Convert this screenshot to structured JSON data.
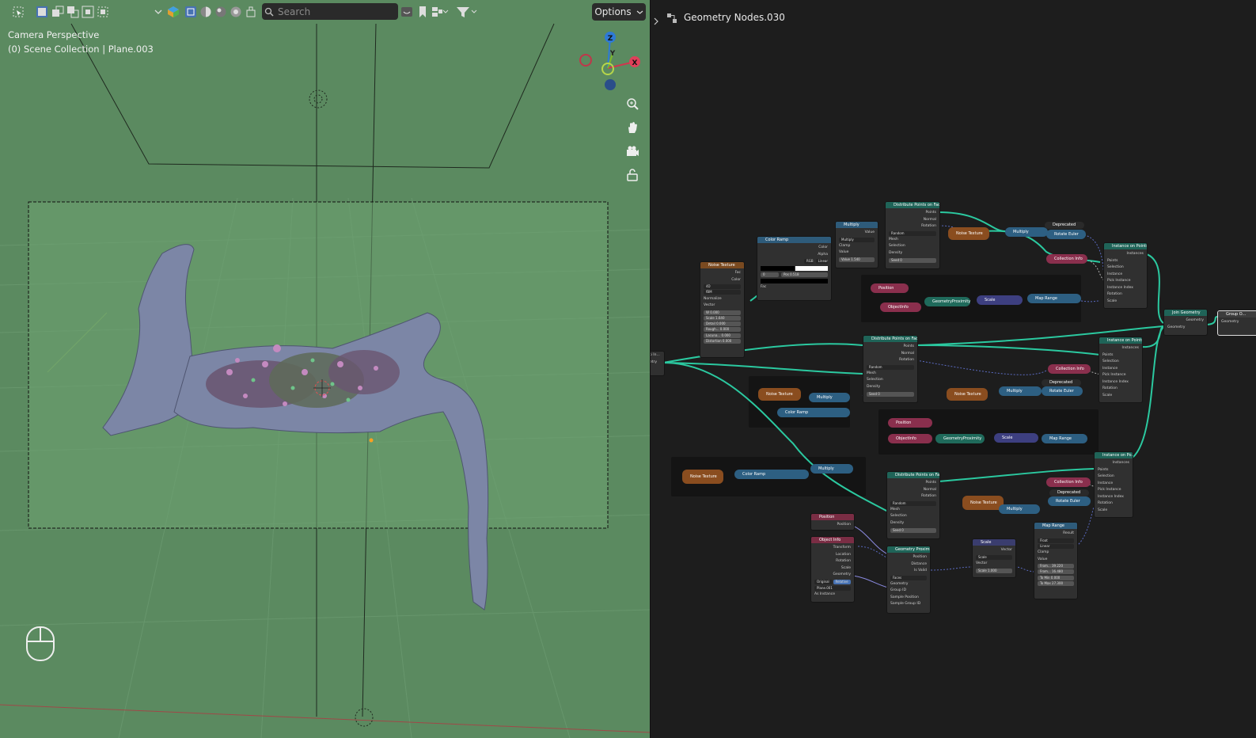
{
  "viewport": {
    "header": {
      "search_placeholder": "Search",
      "options_label": "Options",
      "icons": [
        "select-box-icon",
        "select-new-icon",
        "select-extend-icon",
        "select-subtract-icon",
        "select-intersect-icon",
        "dropdown-icon",
        "object-type-visibility-icon",
        "solid-shading-icon",
        "wireframe-shading-icon",
        "material-preview-icon",
        "rendered-shading-icon",
        "xray-icon",
        "bookmark-icon",
        "view-layer-icon",
        "filter-icon"
      ]
    },
    "overlay": {
      "camera_label": "Camera Perspective",
      "collection_label": "(0) Scene Collection | Plane.003"
    },
    "gizmo": {
      "z_label": "Z",
      "y_label": "Y",
      "x_label": "X"
    },
    "nav_buttons": [
      "zoom-icon",
      "pan-hand-icon",
      "camera-view-icon",
      "lock-icon"
    ],
    "background_color": "#5b8a60"
  },
  "node_editor": {
    "title": "Geometry Nodes.030",
    "group_input_labels": [
      "p In...",
      "etry"
    ],
    "nodes": {
      "noise_texture": {
        "title": "Noise Texture",
        "outputs": [
          "Fac",
          "Color"
        ],
        "dims": "4D",
        "type": "fBM",
        "normalize": "Normalize",
        "vector": "Vector",
        "fields": [
          [
            "W",
            "0.000"
          ],
          [
            "Scale",
            "1.640"
          ],
          [
            "Detail",
            "0.000"
          ],
          [
            "Rough...",
            "0.000"
          ],
          [
            "Lacuna...",
            "0.000"
          ],
          [
            "Distortion",
            "0.000"
          ]
        ]
      },
      "color_ramp": {
        "title": "Color Ramp",
        "outputs": [
          "Color",
          "Alpha"
        ],
        "mode": "RGB",
        "interp": "Linear",
        "index": "0",
        "pos_label": "Pos",
        "pos_value": "0.518",
        "input": "Fac"
      },
      "multiply_top": {
        "title": "Multiply",
        "output": "Value",
        "op": "Multiply",
        "clamp": "Clamp",
        "value_label": "Value",
        "value_field": "Value",
        "value_number": "1.540"
      },
      "distribute_1": {
        "title": "Distribute Points on Faces",
        "outputs": [
          "Points",
          "Normal",
          "Rotation"
        ],
        "mode": "Random",
        "inputs": [
          "Mesh",
          "Selection",
          "Density"
        ],
        "seed_label": "Seed",
        "seed_value": "0"
      },
      "distribute_2": {
        "title": "Distribute Points on Faces",
        "outputs": [
          "Points",
          "Normal",
          "Rotation"
        ],
        "mode": "Random",
        "inputs": [
          "Mesh",
          "Selection",
          "Density"
        ],
        "seed_label": "Seed",
        "seed_value": "0"
      },
      "distribute_3": {
        "title": "Distribute Points on Faces",
        "outputs": [
          "Points",
          "Normal",
          "Rotation"
        ],
        "mode": "Random",
        "inputs": [
          "Mesh",
          "Selection",
          "Density"
        ],
        "seed_label": "Seed",
        "seed_value": "0"
      },
      "instance_1": {
        "title": "Instance on Points",
        "output": "Instances",
        "inputs": [
          "Points",
          "Selection",
          "Instance",
          "Pick Instance",
          "Instance Index",
          "Rotation",
          "Scale"
        ]
      },
      "instance_2": {
        "title": "Instance on Points",
        "output": "Instances",
        "inputs": [
          "Points",
          "Selection",
          "Instance",
          "Pick Instance",
          "Instance Index",
          "Rotation",
          "Scale"
        ]
      },
      "instance_3": {
        "title": "Instance on Po...",
        "output": "Instances",
        "inputs": [
          "Points",
          "Selection",
          "Instance",
          "Pick Instance",
          "Instance Index",
          "Rotation",
          "Scale"
        ]
      },
      "join_geometry": {
        "title": "Join Geometry",
        "output": "Geometry",
        "input": "Geometry"
      },
      "group_output": {
        "title": "Group O...",
        "input": "Geometry"
      },
      "position_node": {
        "title": "Position",
        "output": "Position"
      },
      "object_info": {
        "title": "Object Info",
        "outputs": [
          "Transform",
          "Location",
          "Rotation",
          "Scale",
          "Geometry"
        ],
        "btn_original": "Original",
        "btn_relative": "Relative",
        "object": "Plane.001",
        "as_instance": "As Instance"
      },
      "geometry_proximity": {
        "title": "Geometry Proximity",
        "outputs": [
          "Position",
          "Distance",
          "Is Valid"
        ],
        "mode": "Faces",
        "inputs": [
          "Geometry",
          "Group ID",
          "Sample Position",
          "Sample Group ID"
        ]
      },
      "scale_node": {
        "title": "Scale",
        "output": "Vector",
        "op": "Scale",
        "vector": "Vector",
        "scale_label": "Scale",
        "scale_value": "1.000"
      },
      "map_range": {
        "title": "Map Range",
        "output": "Result",
        "type": "Float",
        "interp": "Linear",
        "clamp": "Clamp",
        "value": "Value",
        "fields": [
          [
            "From...",
            "39.220"
          ],
          [
            "From...",
            "16.480"
          ],
          [
            "To Min",
            "0.000"
          ],
          [
            "To Max",
            "27.300"
          ]
        ]
      }
    },
    "collapsed": {
      "noise_texture": "Noise Texture",
      "multiply": "Multiply",
      "rotate_euler": "Rotate Euler",
      "deprecated": "Deprecated",
      "collection_info": "Collection Info",
      "position": "Position",
      "object_info": "ObjectInfo",
      "geometry_proximity": "GeometryProximity",
      "scale": "Scale",
      "map_range": "Map Range",
      "color_ramp": "Color Ramp"
    }
  }
}
